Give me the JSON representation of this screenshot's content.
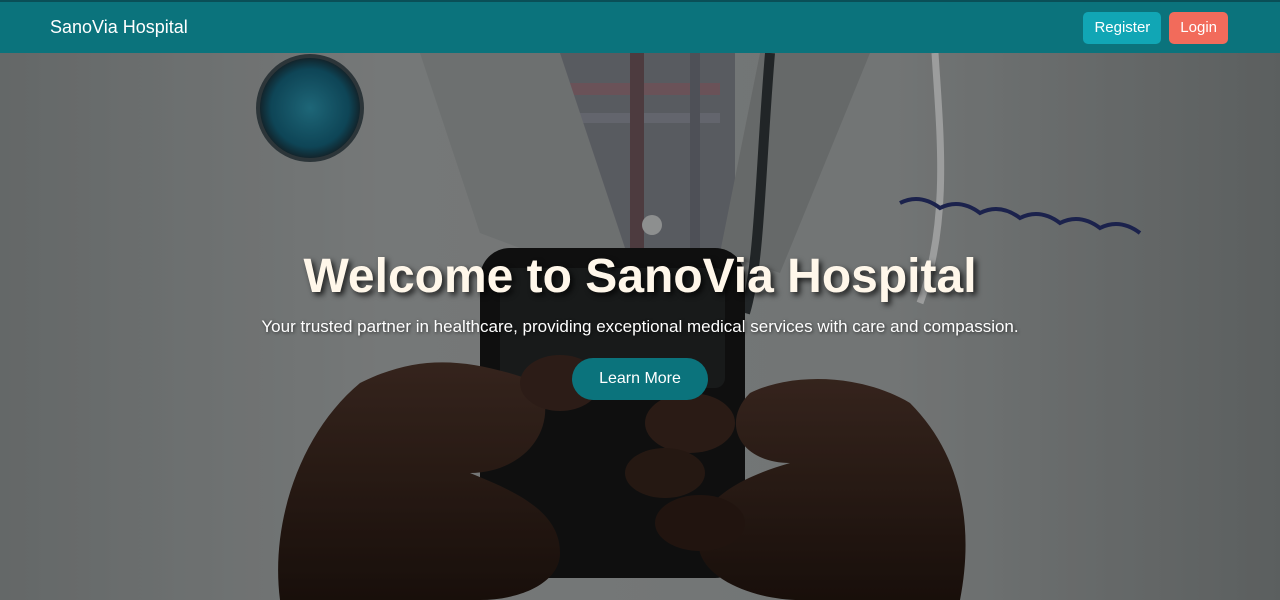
{
  "navbar": {
    "brand": "SanoVia Hospital",
    "register_label": "Register",
    "login_label": "Login",
    "colors": {
      "background": "#0b737c",
      "register": "#11a6b5",
      "login": "#f26b5b"
    }
  },
  "hero": {
    "title": "Welcome to SanoVia Hospital",
    "subtitle": "Your trusted partner in healthcare, providing exceptional medical services with care and compassion.",
    "cta_label": "Learn More",
    "background_image": "doctor-holding-smartphone-photo"
  }
}
